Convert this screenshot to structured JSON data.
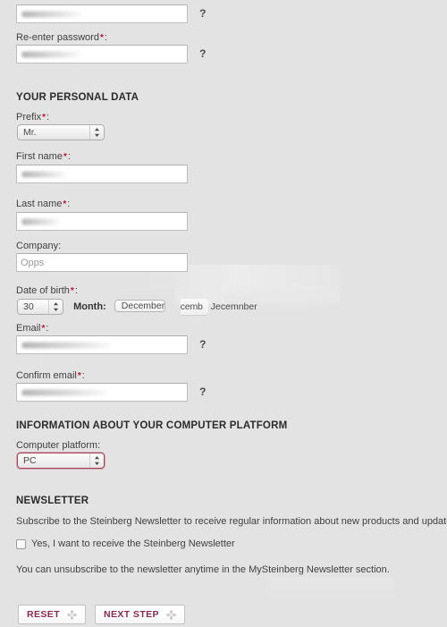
{
  "form": {
    "password": {
      "field_value": "",
      "help_icon": "?"
    },
    "reenter_password": {
      "label": "Re-enter password",
      "required_mark": "*",
      "colon": ":",
      "field_value": "",
      "help_icon": "?"
    },
    "personal_section": {
      "title": "YOUR PERSONAL DATA",
      "prefix": {
        "label": "Prefix",
        "required_mark": "*",
        "colon": ":",
        "value": "Mr."
      },
      "first_name": {
        "label": "First name",
        "required_mark": "*",
        "colon": ":",
        "value": ""
      },
      "last_name": {
        "label": "Last name",
        "required_mark": "*",
        "colon": ":",
        "value": ""
      },
      "company": {
        "label": "Company:",
        "value": "Opps"
      },
      "date_of_birth": {
        "label": "Date of birth",
        "required_mark": "*",
        "colon": ":",
        "day_value": "30",
        "month_label": "Month:",
        "month_value": "December",
        "month_ghost_1": "cemb",
        "month_ghost_2": "Jecemnber"
      },
      "email": {
        "label": "Email",
        "required_mark": "*",
        "colon": ":",
        "value": "",
        "help_icon": "?"
      },
      "confirm_email": {
        "label": "Confirm email",
        "required_mark": "*",
        "colon": ":",
        "value": "",
        "help_icon": "?"
      }
    },
    "platform_section": {
      "title": "INFORMATION ABOUT YOUR COMPUTER PLATFORM",
      "platform": {
        "label": "Computer platform:",
        "value": "PC"
      }
    },
    "newsletter_section": {
      "title": "NEWSLETTER",
      "intro": "Subscribe to the Steinberg Newsletter to receive regular information about new products and updates:",
      "checkbox_label": "Yes, I want to receive the Steinberg Newsletter",
      "checked": false,
      "note": "You can unsubscribe to the newsletter anytime in the MySteinberg Newsletter section."
    },
    "actions": {
      "reset_label": "RESET",
      "next_label": "NEXT STEP",
      "icon_name": "move-crosshair-icon"
    },
    "colors": {
      "page_background": "#e3e3e3",
      "required_red": "#b5123a",
      "button_text": "#8a2a48",
      "error_border": "#a8405c"
    }
  }
}
